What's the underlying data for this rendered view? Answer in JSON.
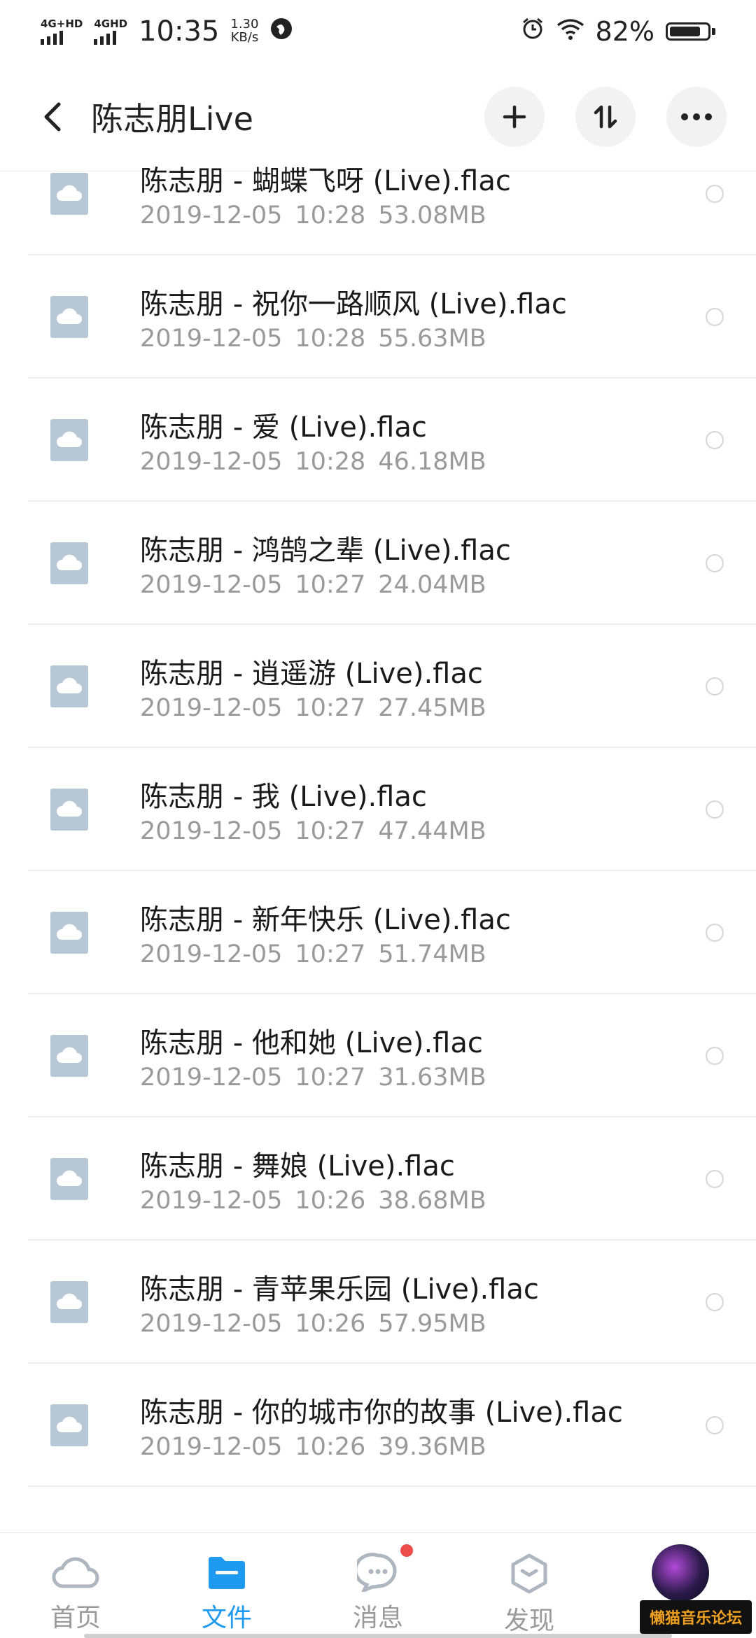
{
  "status_bar": {
    "net1": "4G+HD",
    "net2": "4GHD",
    "time": "10:35",
    "speed_value": "1.30",
    "speed_unit": "KB/s",
    "battery_percent": "82%",
    "battery_level": 0.82
  },
  "header": {
    "title": "陈志朋Live",
    "add_icon": "plus-icon",
    "sort_icon": "sort-icon",
    "more_icon": "more-icon"
  },
  "files": [
    {
      "name": "陈志朋 - 蝴蝶飞呀 (Live).flac",
      "date": "2019-12-05",
      "time": "10:28",
      "size": "53.08MB"
    },
    {
      "name": "陈志朋 - 祝你一路顺风 (Live).flac",
      "date": "2019-12-05",
      "time": "10:28",
      "size": "55.63MB"
    },
    {
      "name": "陈志朋 - 爱 (Live).flac",
      "date": "2019-12-05",
      "time": "10:28",
      "size": "46.18MB"
    },
    {
      "name": "陈志朋 - 鸿鹄之辈 (Live).flac",
      "date": "2019-12-05",
      "time": "10:27",
      "size": "24.04MB"
    },
    {
      "name": "陈志朋 - 逍遥游 (Live).flac",
      "date": "2019-12-05",
      "time": "10:27",
      "size": "27.45MB"
    },
    {
      "name": "陈志朋 - 我 (Live).flac",
      "date": "2019-12-05",
      "time": "10:27",
      "size": "47.44MB"
    },
    {
      "name": "陈志朋 - 新年快乐 (Live).flac",
      "date": "2019-12-05",
      "time": "10:27",
      "size": "51.74MB"
    },
    {
      "name": "陈志朋 - 他和她 (Live).flac",
      "date": "2019-12-05",
      "time": "10:27",
      "size": "31.63MB"
    },
    {
      "name": "陈志朋 - 舞娘 (Live).flac",
      "date": "2019-12-05",
      "time": "10:26",
      "size": "38.68MB"
    },
    {
      "name": "陈志朋 - 青苹果乐园 (Live).flac",
      "date": "2019-12-05",
      "time": "10:26",
      "size": "57.95MB"
    },
    {
      "name": "陈志朋 - 你的城市你的故事 (Live).flac",
      "date": "2019-12-05",
      "time": "10:26",
      "size": "39.36MB"
    }
  ],
  "bottom_nav": {
    "home": "首页",
    "files": "文件",
    "messages": "消息",
    "discover": "发现"
  },
  "watermark": "懒猫音乐论坛",
  "colors": {
    "accent": "#1e9bf0",
    "badge": "#ef4a4a",
    "file_icon": "#b8c7d6"
  }
}
